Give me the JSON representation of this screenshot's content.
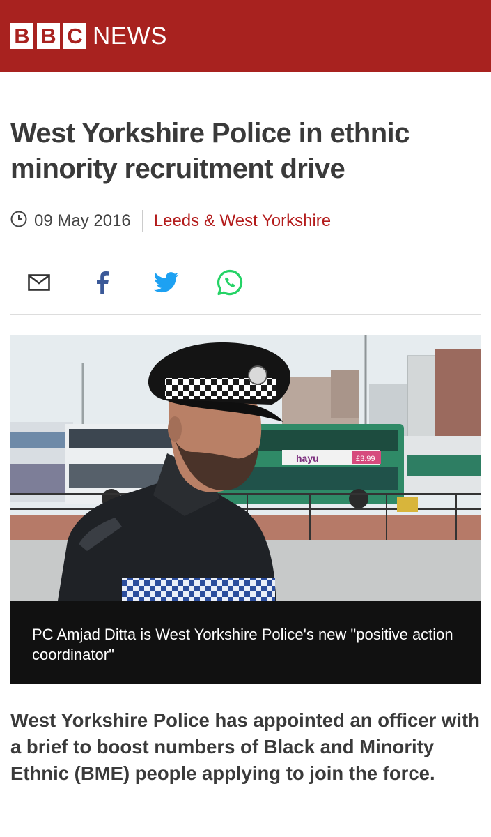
{
  "brand": {
    "letters": [
      "B",
      "B",
      "C"
    ],
    "product": "NEWS",
    "header_color": "#a8221f"
  },
  "article": {
    "headline": "West Yorkshire Police in ethnic minority recruitment drive",
    "date": "09 May 2016",
    "section": "Leeds & West Yorkshire",
    "image_caption": "PC Amjad Ditta is West Yorkshire Police's new \"positive action coordinator\"",
    "summary": "West Yorkshire Police has appointed an officer with a brief to boost numbers of Black and Minority Ethnic (BME) people applying to join the force.",
    "image_bus_ad_text": "hayu",
    "image_bus_price": "£3.99"
  },
  "share": {
    "icons": [
      "email-icon",
      "facebook-icon",
      "twitter-icon",
      "whatsapp-icon"
    ],
    "colors": {
      "email": "#333333",
      "facebook": "#3b5998",
      "twitter": "#1da1f2",
      "whatsapp": "#25d366"
    }
  },
  "meta": {
    "clock_icon": "clock-icon"
  }
}
